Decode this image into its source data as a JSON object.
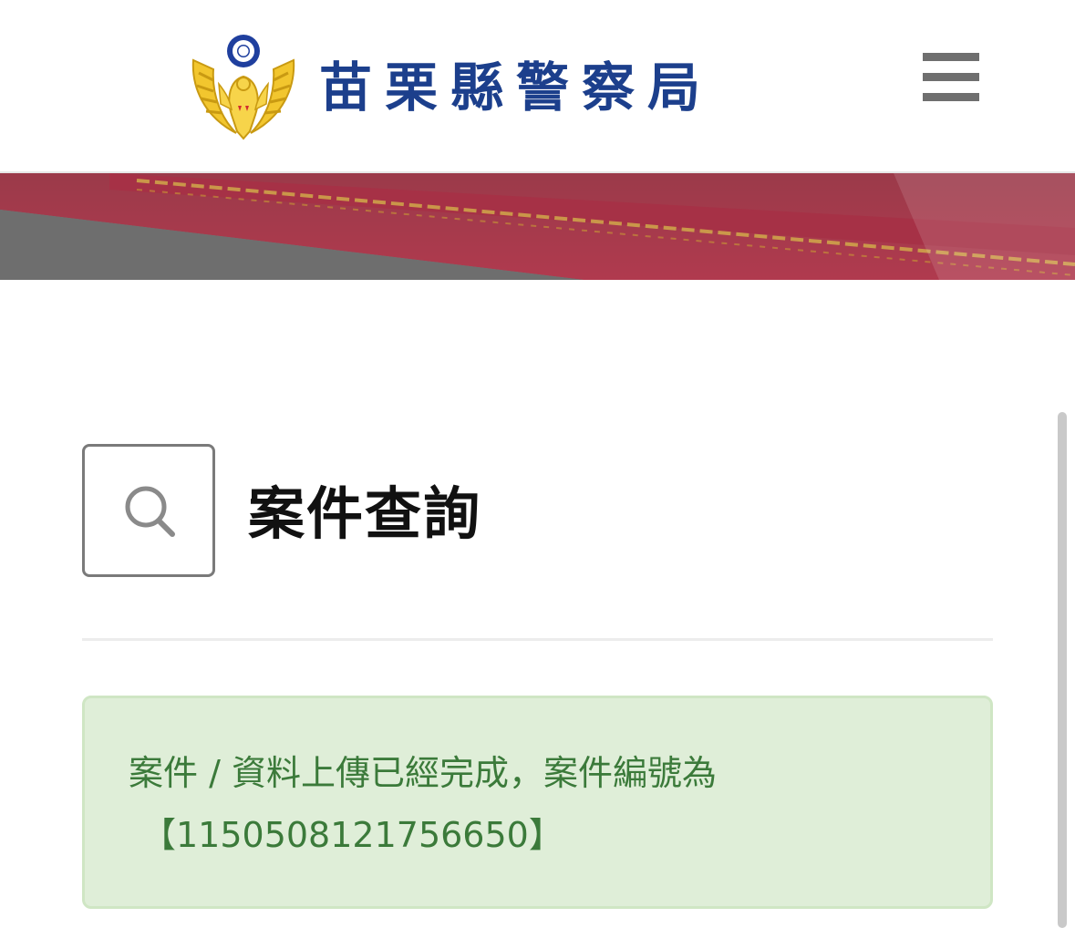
{
  "header": {
    "site_title": "苗栗縣警察局",
    "logo_icon": "police-emblem-icon",
    "menu_icon": "hamburger-menu-icon"
  },
  "banner": {
    "image": "banner-image"
  },
  "main": {
    "title_icon": "search-icon",
    "page_title": "案件查詢"
  },
  "alert": {
    "type": "success",
    "line1": "案件 / 資料上傳已經完成，案件編號為",
    "line2": "【1150508121756650】"
  },
  "colors": {
    "brand_blue": "#1c3f8c",
    "success_bg": "#dfeed8",
    "success_text": "#3b7a3a",
    "menu_gray": "#6f6f6f"
  }
}
